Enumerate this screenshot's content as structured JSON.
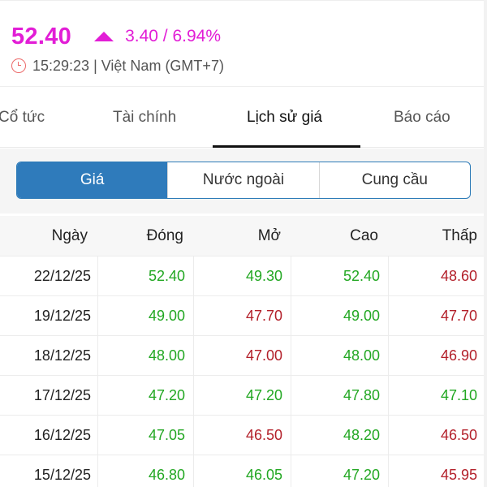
{
  "header": {
    "price": "52.40",
    "change": "3.40 / 6.94%",
    "time": "15:29:23 | Việt Nam (GMT+7)",
    "price_color": "#e21ed6"
  },
  "tabs": [
    {
      "label": "Cổ tức",
      "active": false
    },
    {
      "label": "Tài chính",
      "active": false
    },
    {
      "label": "Lịch sử giá",
      "active": true
    },
    {
      "label": "Báo cáo",
      "active": false
    }
  ],
  "segments": [
    {
      "label": "Giá",
      "active": true
    },
    {
      "label": "Nước ngoài",
      "active": false
    },
    {
      "label": "Cung cầu",
      "active": false
    }
  ],
  "table": {
    "columns": [
      "Ngày",
      "Đóng",
      "Mở",
      "Cao",
      "Thấp"
    ],
    "rows": [
      {
        "date": "22/12/25",
        "close": {
          "v": "52.40",
          "c": "green"
        },
        "open": {
          "v": "49.30",
          "c": "green"
        },
        "high": {
          "v": "52.40",
          "c": "green"
        },
        "low": {
          "v": "48.60",
          "c": "red"
        }
      },
      {
        "date": "19/12/25",
        "close": {
          "v": "49.00",
          "c": "green"
        },
        "open": {
          "v": "47.70",
          "c": "red"
        },
        "high": {
          "v": "49.00",
          "c": "green"
        },
        "low": {
          "v": "47.70",
          "c": "red"
        }
      },
      {
        "date": "18/12/25",
        "close": {
          "v": "48.00",
          "c": "green"
        },
        "open": {
          "v": "47.00",
          "c": "red"
        },
        "high": {
          "v": "48.00",
          "c": "green"
        },
        "low": {
          "v": "46.90",
          "c": "red"
        }
      },
      {
        "date": "17/12/25",
        "close": {
          "v": "47.20",
          "c": "green"
        },
        "open": {
          "v": "47.20",
          "c": "green"
        },
        "high": {
          "v": "47.80",
          "c": "green"
        },
        "low": {
          "v": "47.10",
          "c": "green"
        }
      },
      {
        "date": "16/12/25",
        "close": {
          "v": "47.05",
          "c": "green"
        },
        "open": {
          "v": "46.50",
          "c": "red"
        },
        "high": {
          "v": "48.20",
          "c": "green"
        },
        "low": {
          "v": "46.50",
          "c": "red"
        }
      },
      {
        "date": "15/12/25",
        "close": {
          "v": "46.80",
          "c": "green"
        },
        "open": {
          "v": "46.05",
          "c": "green"
        },
        "high": {
          "v": "47.20",
          "c": "green"
        },
        "low": {
          "v": "45.95",
          "c": "red"
        }
      }
    ],
    "colors": {
      "green": "#22a722",
      "red": "#b3202a"
    }
  }
}
